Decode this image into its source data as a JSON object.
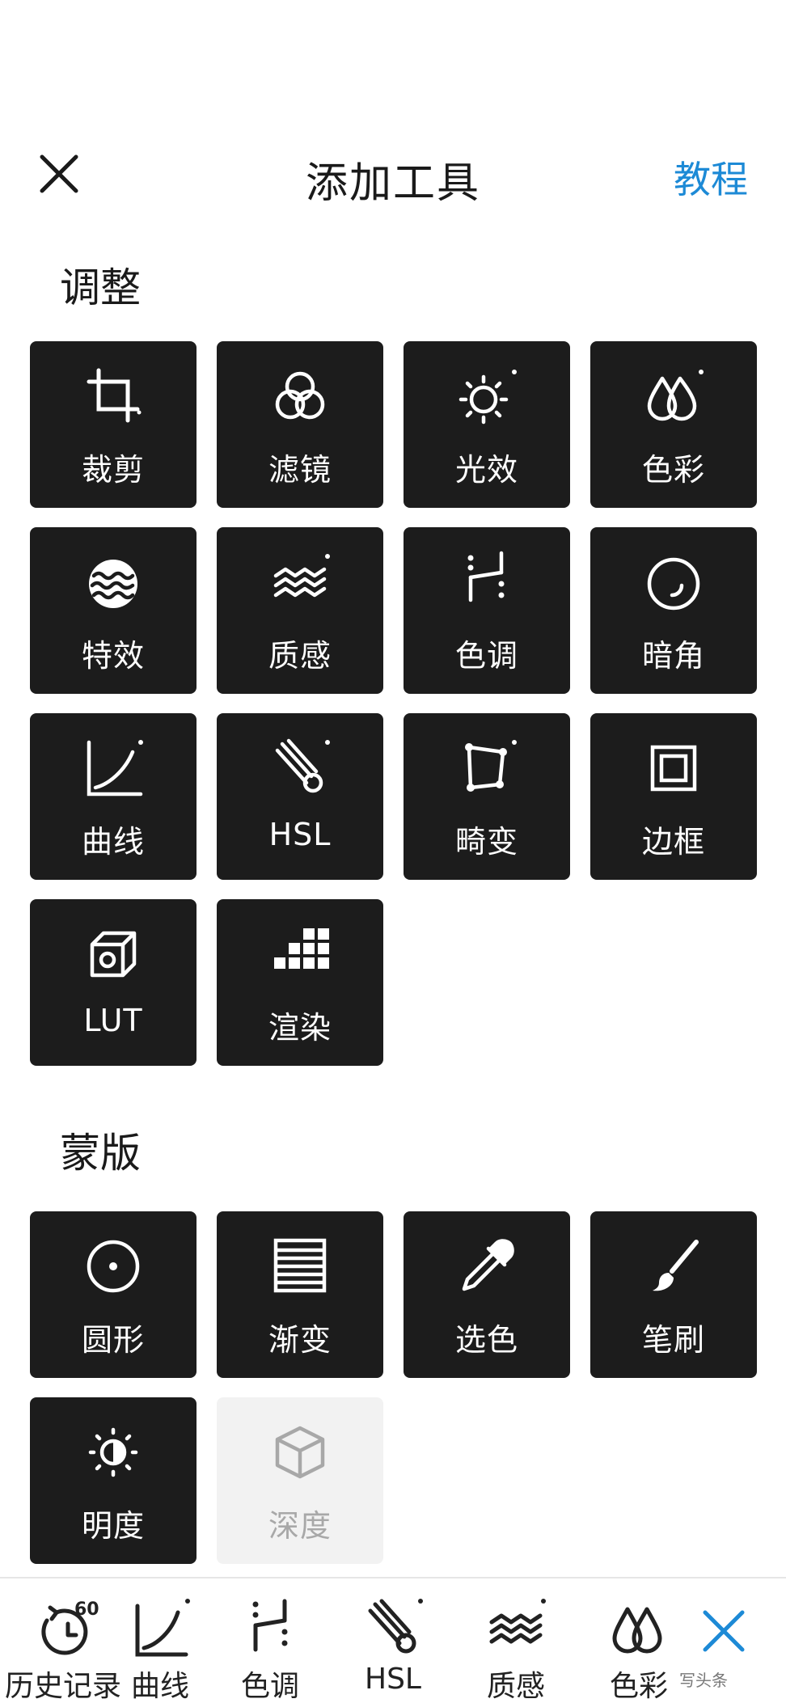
{
  "header": {
    "title": "添加工具",
    "tutorial_label": "教程"
  },
  "sections": {
    "adjust": {
      "title": "调整",
      "tools": [
        {
          "label": "裁剪",
          "icon": "crop-icon"
        },
        {
          "label": "滤镜",
          "icon": "filter-icon"
        },
        {
          "label": "光效",
          "icon": "sun-icon"
        },
        {
          "label": "色彩",
          "icon": "drops-icon"
        },
        {
          "label": "特效",
          "icon": "waves-circle-icon"
        },
        {
          "label": "质感",
          "icon": "texture-icon"
        },
        {
          "label": "色调",
          "icon": "tone-icon"
        },
        {
          "label": "暗角",
          "icon": "vignette-icon"
        },
        {
          "label": "曲线",
          "icon": "curve-icon"
        },
        {
          "label": "HSL",
          "icon": "hsl-icon"
        },
        {
          "label": "畸变",
          "icon": "distort-icon"
        },
        {
          "label": "边框",
          "icon": "frame-icon"
        },
        {
          "label": "LUT",
          "icon": "lut-cube-icon"
        },
        {
          "label": "渲染",
          "icon": "render-grid-icon"
        }
      ]
    },
    "mask": {
      "title": "蒙版",
      "tools": [
        {
          "label": "圆形",
          "icon": "circle-mask-icon"
        },
        {
          "label": "渐变",
          "icon": "gradient-icon"
        },
        {
          "label": "选色",
          "icon": "eyedropper-icon"
        },
        {
          "label": "笔刷",
          "icon": "brush-icon"
        },
        {
          "label": "明度",
          "icon": "luminance-icon"
        },
        {
          "label": "深度",
          "icon": "depth-cube-icon",
          "disabled": true
        }
      ]
    }
  },
  "bottom_bar": {
    "items": [
      {
        "label": "历史记录",
        "icon": "history-icon",
        "badge": "60"
      },
      {
        "label": "曲线",
        "icon": "curve-icon"
      },
      {
        "label": "色调",
        "icon": "tone-icon"
      },
      {
        "label": "HSL",
        "icon": "hsl-icon"
      },
      {
        "label": "质感",
        "icon": "texture-icon"
      },
      {
        "label": "色彩",
        "icon": "drops-icon"
      }
    ],
    "close_icon": "close-icon"
  },
  "watermark": "写头条",
  "colors": {
    "accent": "#1d8ad6",
    "tile_bg": "#1c1c1c",
    "tile_disabled_bg": "#f2f2f2"
  }
}
